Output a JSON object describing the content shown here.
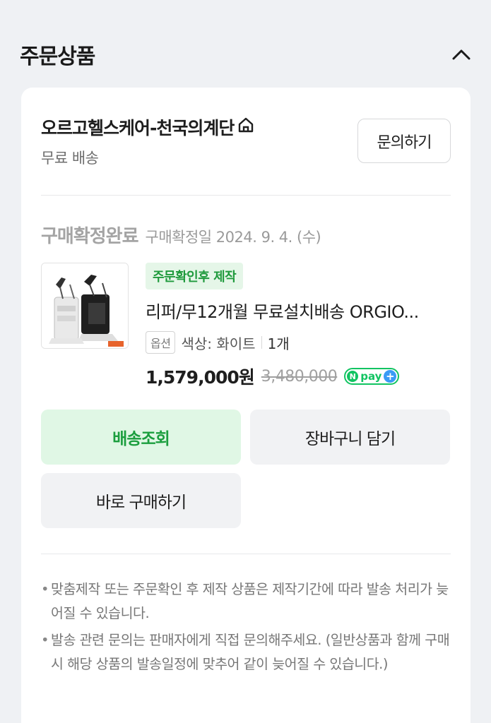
{
  "section": {
    "title": "주문상품"
  },
  "seller": {
    "name": "오르고헬스케어-천국의계단",
    "shipping": "무료 배송",
    "inquiry_label": "문의하기"
  },
  "order": {
    "status": "구매확정완료",
    "status_date": "구매확정일 2024. 9. 4. (수)",
    "tag": "주문확인후 제작",
    "product_name": "리퍼/무12개월 무료설치배송 ORGIO...",
    "option_badge": "옵션",
    "option_value": "색상: 화이트",
    "quantity": "1개",
    "price": "1,579,000원",
    "original_price": "3,480,000",
    "npay": {
      "n": "N",
      "text": "pay",
      "plus": "+"
    }
  },
  "actions": {
    "track": "배송조회",
    "cart": "장바구니 담기",
    "buy": "바로 구매하기"
  },
  "notes": [
    "맞춤제작 또는 주문확인 후 제작 상품은 제작기간에 따라 발송 처리가 늦어질 수 있습니다.",
    "발송 관련 문의는 판매자에게 직접 문의해주세요. (일반상품과 함께 구매 시 해당 상품의 발송일정에 맞추어 같이 늦어질 수 있습니다.)"
  ],
  "colors": {
    "accent_green": "#1b9e3e",
    "track_bg": "#e0f7e5",
    "npay_green": "#12c462",
    "npay_blue": "#3a9bf5"
  },
  "icons": {
    "collapse": "chevron-up-icon",
    "store": "home-icon"
  }
}
